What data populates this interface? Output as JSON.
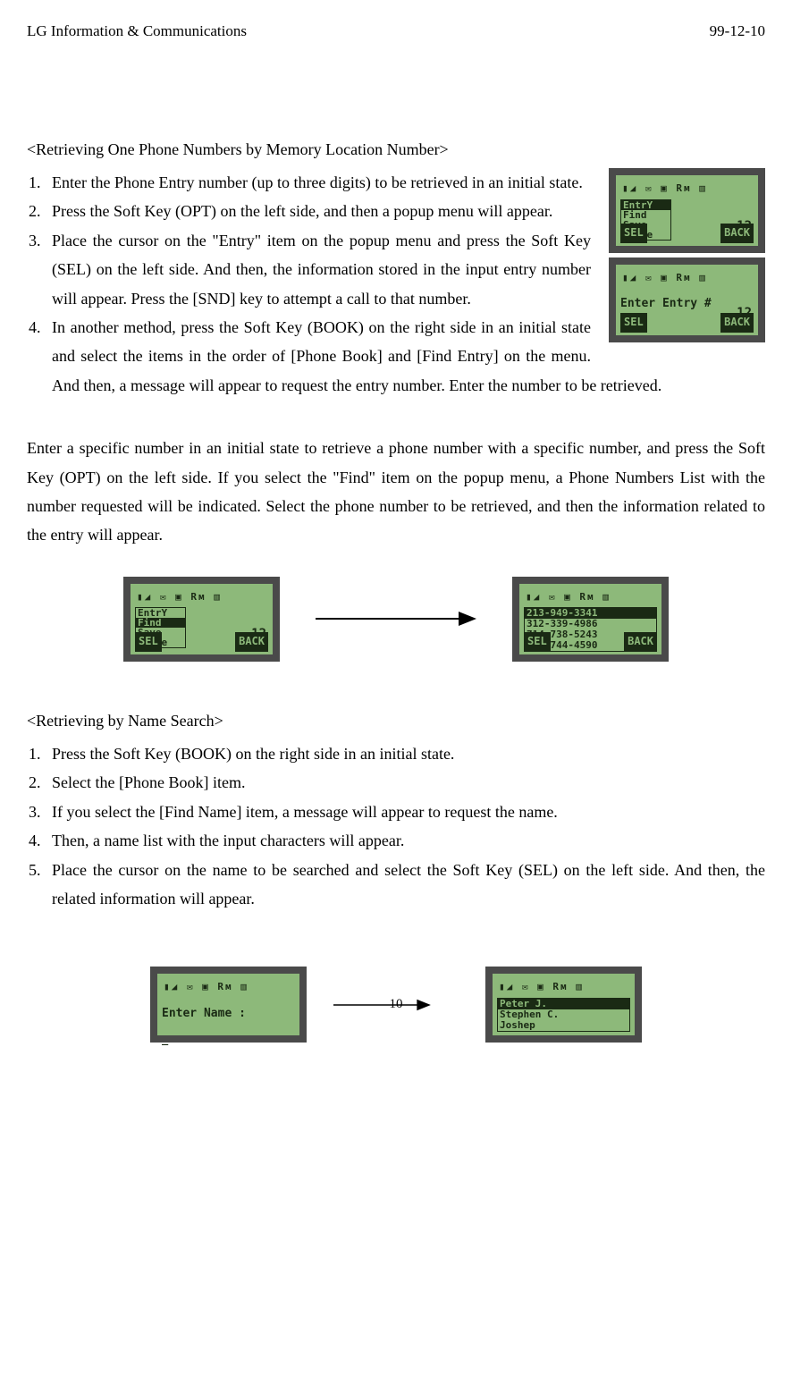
{
  "header": {
    "left": "LG Information & Communications",
    "right": "99-12-10"
  },
  "section1": {
    "title": "<Retrieving One Phone Numbers by Memory Location Number>",
    "steps": [
      "Enter the Phone Entry number (up to three digits) to be retrieved in an initial state.",
      "Press the Soft Key (OPT) on the left side, and then a popup menu will appear.",
      "Place the cursor on the \"Entry\" item on the popup menu and press the Soft Key (SEL) on the left side. And then, the information stored in the input entry number will appear. Press the [SND] key to attempt a call to that number.",
      "In another method, press the Soft Key (BOOK) on the right side in an initial state and select the items in the order of [Phone Book] and [Find Entry] on the menu. And then, a message will appear to request the entry number. Enter the number to be retrieved."
    ],
    "paragraph": "Enter a specific number in an initial state to retrieve a phone number with a specific number, and press the Soft Key (OPT) on the left side. If you select the \"Find\" item on the popup menu, a Phone Numbers List with the number requested will be indicated. Select the phone number to be retrieved, and then the information related to the entry will appear."
  },
  "section2": {
    "title": "<Retrieving by Name Search>",
    "steps": [
      "Press the Soft Key (BOOK) on the right side in an initial state.",
      "Select the [Phone Book] item.",
      "If you select the [Find Name] item, a message will appear to request the name.",
      "Then, a name list with the input characters will appear.",
      "Place the cursor on the name to be searched and select the Soft Key (SEL) on the left side. And then, the related information will appear."
    ]
  },
  "lcd": {
    "icons": "▮◢ ✉ ▣ Rм ▥",
    "menu": {
      "items": [
        "EntrY",
        "Find",
        "Save",
        "Pause"
      ],
      "selected": 0
    },
    "number": "12",
    "softkey_left": "SEL",
    "softkey_right": "BACK",
    "enter_entry": "Enter Entry #",
    "enter_name": "Enter Name :",
    "phone_list": [
      "213-949-3341",
      "312-339-4986",
      "714-738-5243",
      "405-744-4590"
    ],
    "name_list": [
      "Peter J.",
      "Stephen C.",
      "Joshep"
    ],
    "find_selected": 1
  },
  "page_number": "10"
}
